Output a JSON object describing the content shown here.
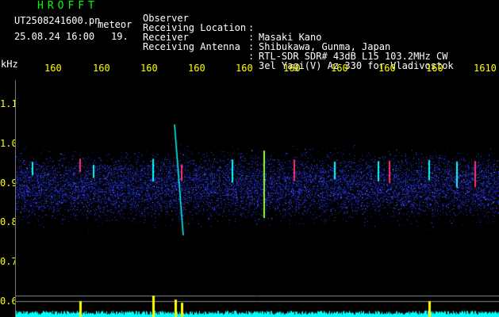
{
  "header": {
    "app_title": "HROFFT",
    "filename": "UT2508241600.pn",
    "meteor_label": "meteor",
    "datetime": "25.08.24 16:00",
    "count": "19."
  },
  "info": [
    {
      "label": "Observer",
      "value": "Masaki Kano"
    },
    {
      "label": "Receiving Location",
      "value": "Shibukawa, Gunma, Japan"
    },
    {
      "label": "Receiver",
      "value": "RTL-SDR SDR# 43dB L15 103.2MHz CW"
    },
    {
      "label": "Receiving Antenna",
      "value": "3el Yagi(V) Az 330 for Vladivostok"
    }
  ],
  "axis": {
    "unit": "kHz",
    "x_ticks": [
      "160",
      "160",
      "160",
      "160",
      "160",
      "160",
      "160",
      "160",
      "160",
      "1610"
    ],
    "y_ticks": [
      "1.1",
      "1.0",
      "0.9",
      "0.8",
      "0.7",
      "0.6"
    ]
  },
  "colors": {
    "background": "#000000",
    "text_white": "#ffffff",
    "text_yellow": "#ffff00",
    "text_green": "#00ff00",
    "noise_blue": "#3344ff",
    "signal_cyan": "#00ffff",
    "monitor_trace": "#00ffff",
    "monitor_peak": "#ffff00"
  }
}
